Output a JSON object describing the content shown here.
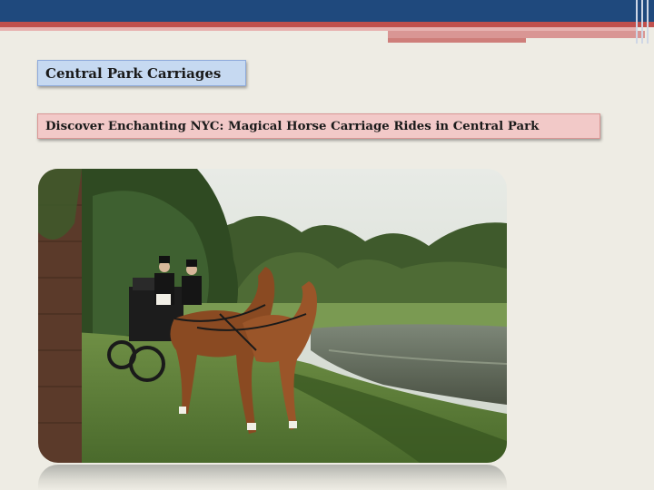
{
  "slide": {
    "title": "Central Park Carriages",
    "subtitle": "Discover Enchanting NYC: Magical Horse Carriage Rides in Central Park"
  },
  "image": {
    "subject": "horse-drawn-carriage-photo"
  },
  "colors": {
    "top_band": "#1f497d",
    "accent_red": "#c0504d",
    "title_fill": "#c6d9f1",
    "subtitle_fill": "#f2c9c8",
    "background": "#eeece4"
  }
}
